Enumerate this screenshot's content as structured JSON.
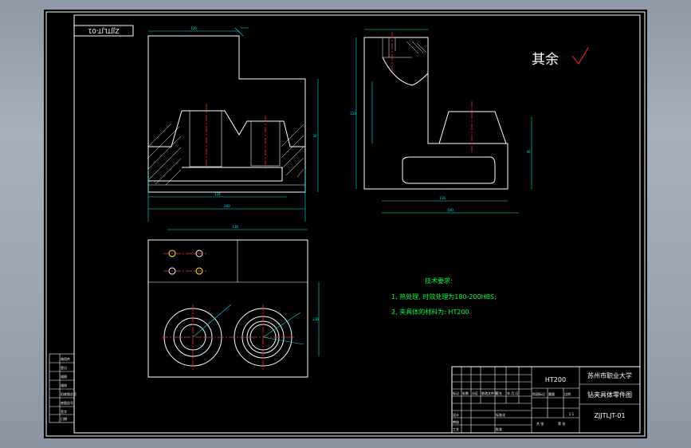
{
  "drawing": {
    "remaining_roughness_label": "其余",
    "rotated_code": "ZJJTLJT-01",
    "dimension_labels": [
      "120",
      "134",
      "56",
      "155",
      "84",
      "200",
      "30",
      "120",
      "40",
      "116",
      "100",
      "200",
      "138",
      "236",
      "R5",
      "R15"
    ]
  },
  "tech": {
    "title": "技术要求:",
    "line1": "1, 热处理, 时效处理为180-200HBS;",
    "line2": "2, 夹具体的材料为: HT200"
  },
  "title_block": {
    "material": "HT200",
    "school": "苏州市职业大学",
    "part_name": "钻夹具体零件图",
    "drawing_no": "ZJJTLJT-01",
    "scale": "1:1",
    "cells_top": [
      "标记",
      "处数",
      "分区",
      "更改文件号",
      "签名",
      "年.月.日"
    ],
    "cells_mid": [
      "设计",
      "标准化",
      "阶段标记",
      "重量",
      "比例"
    ],
    "cells_bot": [
      "审核",
      "工艺",
      "批准",
      "共 张",
      "第 张"
    ]
  },
  "left_strip": [
    "借用件",
    "登记",
    "描图",
    "描校",
    "旧底图总号",
    "底图总号",
    "签字",
    "日期"
  ]
}
